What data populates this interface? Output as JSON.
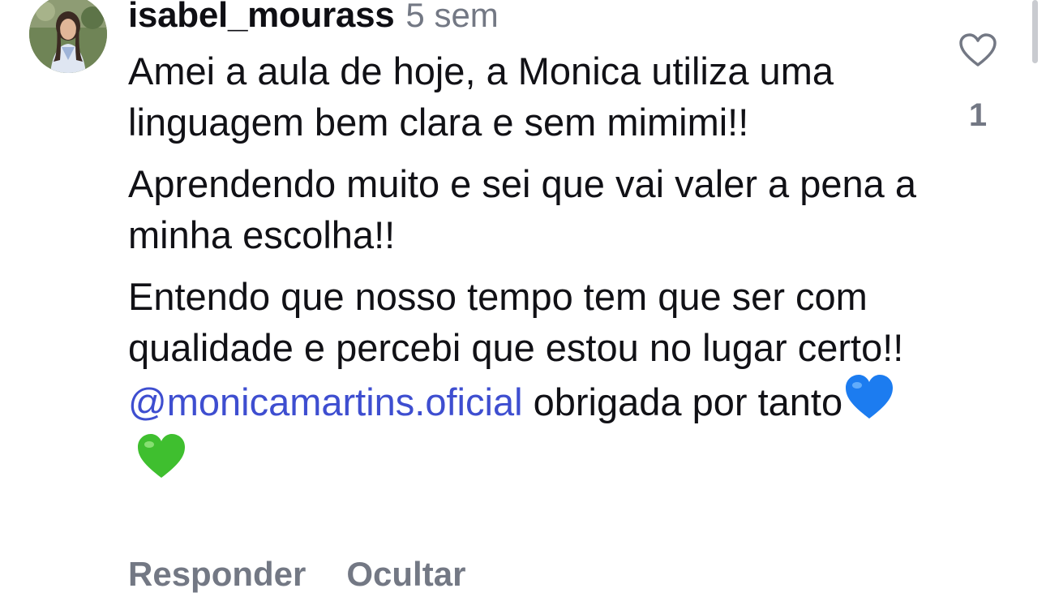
{
  "comment": {
    "username": "isabel_mourass",
    "timestamp": "5 sem",
    "paragraphs": {
      "p1": "Amei a aula de hoje, a Monica utiliza uma linguagem bem clara e sem mimimi!!",
      "p2": "Aprendendo muito e sei que vai valer a pena a minha escolha!!",
      "p3_text": "Entendo que nosso tempo tem que ser com qualidade e percebi que estou no lugar certo!!",
      "p3_mention": "@monicamartins.oficial",
      "p3_tail": "obrigada por tanto"
    },
    "emojis": [
      "blue-heart",
      "green-heart"
    ],
    "like_count": "1",
    "actions": {
      "reply": "Responder",
      "hide": "Ocultar"
    }
  },
  "colors": {
    "mention": "#3e4ed0",
    "muted": "#737884",
    "text": "#111116",
    "blue_heart": "#1c7cf0",
    "green_heart": "#3fbf2f"
  }
}
